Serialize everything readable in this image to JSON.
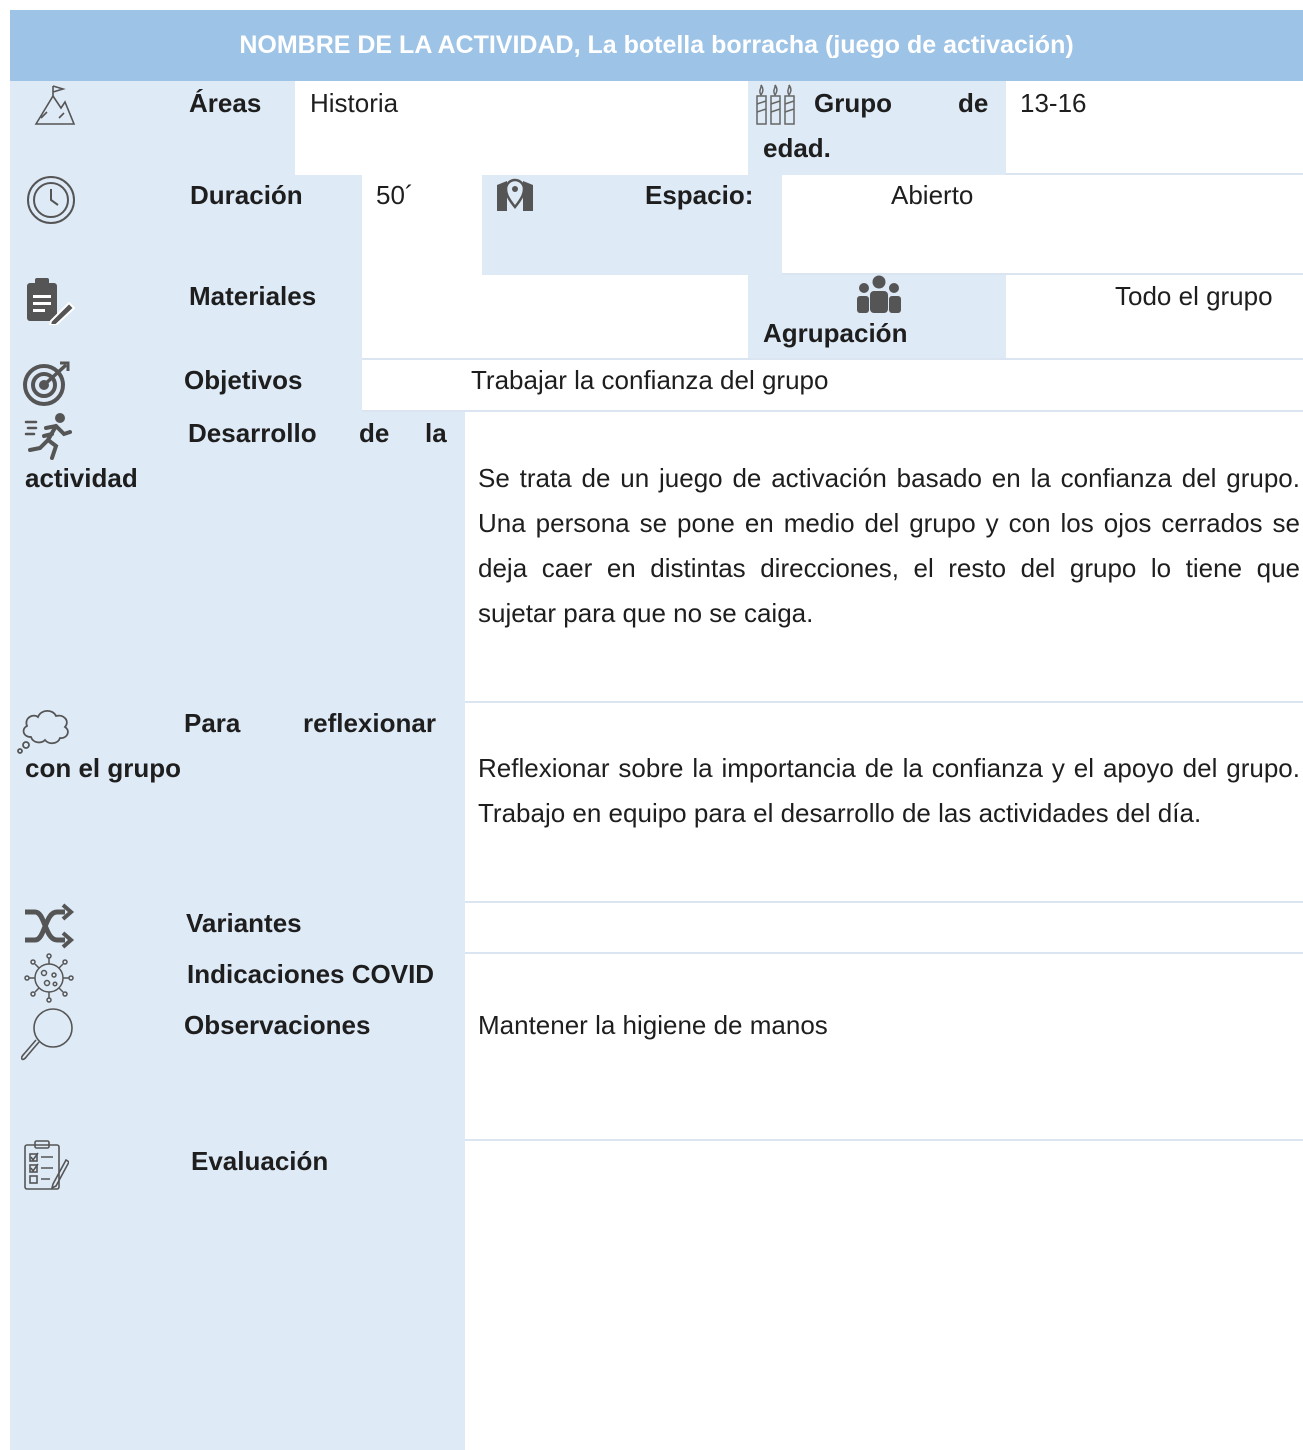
{
  "title": "NOMBRE DE LA ACTIVIDAD, La botella borracha (juego de activación)",
  "areas": {
    "label": "Áreas",
    "value": "Historia"
  },
  "grupo_edad": {
    "label_1": "Grupo",
    "label_2": "de",
    "label_3": "edad.",
    "value": "13-16"
  },
  "duracion": {
    "label": "Duración",
    "value": "50´"
  },
  "espacio": {
    "label": "Espacio:",
    "value": "Abierto"
  },
  "materiales": {
    "label": "Materiales",
    "value": ""
  },
  "agrupacion": {
    "label": "Agrupación",
    "value": "Todo el grupo"
  },
  "objetivos": {
    "label": "Objetivos",
    "value": "Trabajar la confianza del grupo"
  },
  "desarrollo": {
    "label_1": "Desarrollo",
    "label_2": "de",
    "label_3": "la",
    "label_4": "actividad",
    "text": "Se trata de un  juego de activación basado en la confianza del grupo. Una persona se pone en medio del grupo y con los ojos cerrados se deja caer en distintas direcciones, el resto del grupo lo tiene que sujetar para que no se caiga."
  },
  "reflexionar": {
    "label_1": "Para",
    "label_2": "reflexionar",
    "label_3": "con el grupo",
    "text": "Reflexionar sobre la importancia de la confianza y  el apoyo del grupo. Trabajo en equipo para el desarrollo de las actividades del día."
  },
  "variantes": {
    "label": "Variantes",
    "value": ""
  },
  "covid": {
    "label": "Indicaciones COVID",
    "value": ""
  },
  "observaciones": {
    "label": "Observaciones",
    "value": "Mantener la higiene de manos"
  },
  "evaluacion": {
    "label": "Evaluación",
    "value": ""
  },
  "icons": [
    "mountain-flag-icon",
    "candles-icon",
    "clock-icon",
    "map-pin-icon",
    "clipboard-pen-icon",
    "group-people-icon",
    "target-icon",
    "running-person-icon",
    "thought-cloud-icon",
    "shuffle-icon",
    "virus-icon",
    "magnifier-icon",
    "checklist-icon"
  ],
  "colors": {
    "header": "#9dc3e6",
    "label_bg": "#deeaf6",
    "text": "#1e1e1e"
  }
}
